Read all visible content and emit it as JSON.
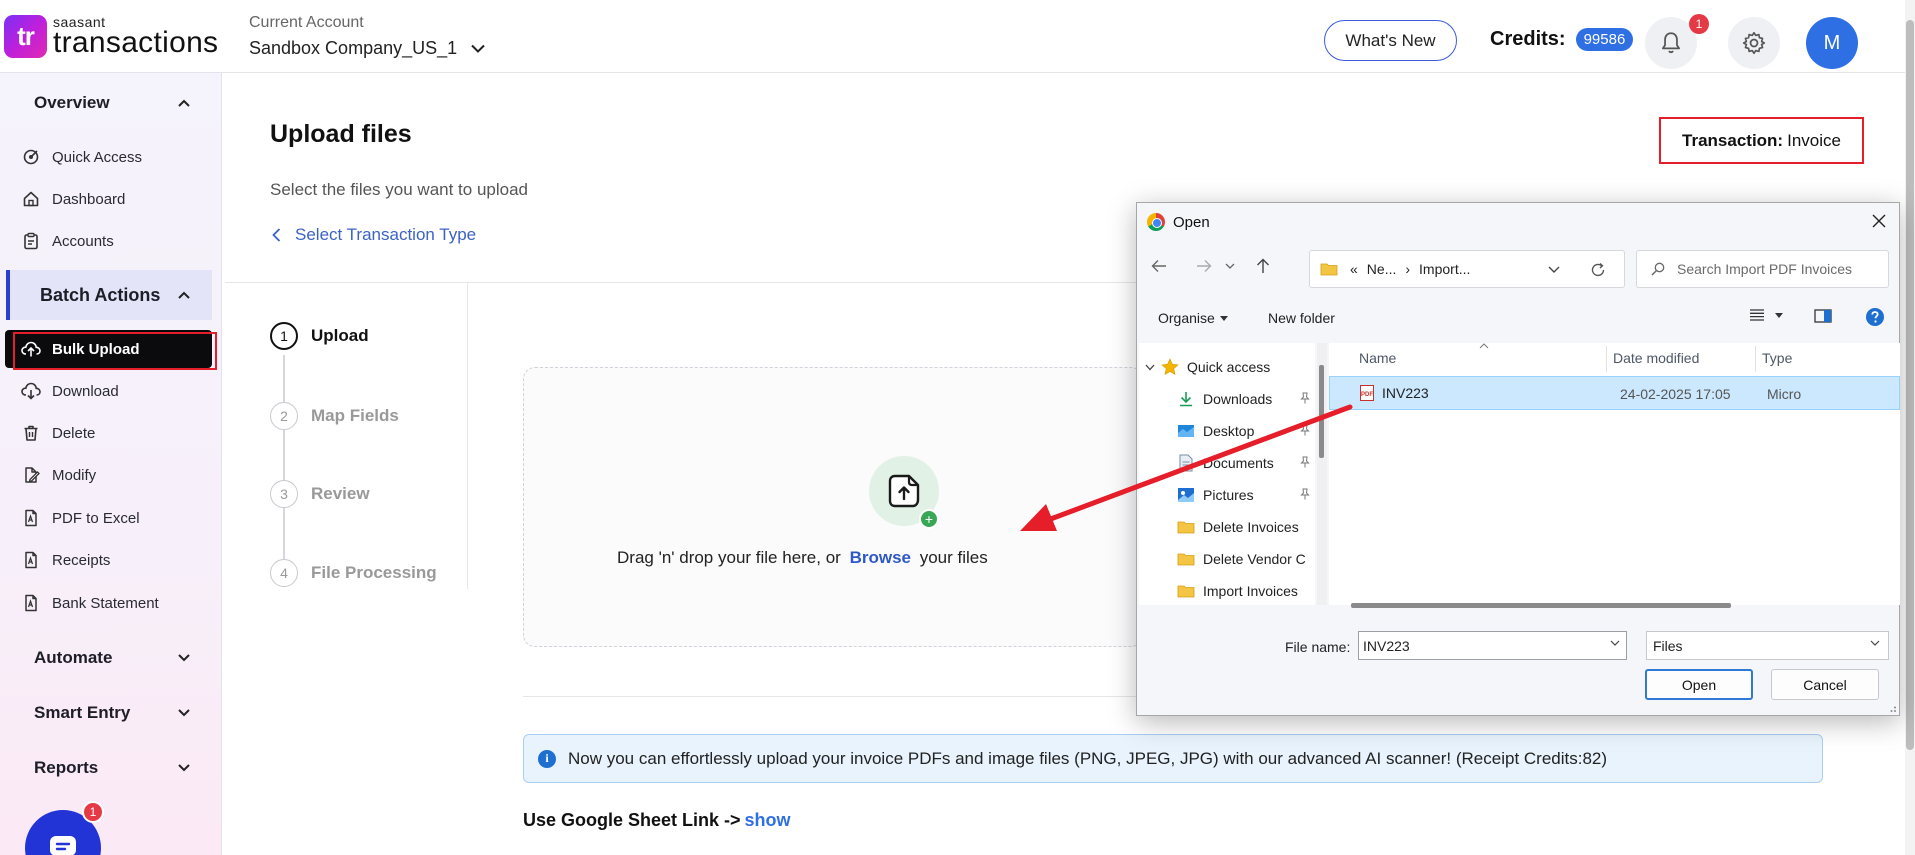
{
  "logo": {
    "line1": "saasant",
    "line2": "transactions",
    "mark": "tr"
  },
  "account": {
    "label": "Current Account",
    "name": "Sandbox Company_US_1"
  },
  "header": {
    "whats_new": "What's New",
    "credits_label": "Credits:",
    "credits_value": "99586",
    "notification_count": "1",
    "avatar_initial": "M"
  },
  "sidebar": {
    "overview": "Overview",
    "overview_items": [
      "Quick Access",
      "Dashboard",
      "Accounts"
    ],
    "batch_actions": "Batch Actions",
    "batch_items": [
      "Bulk Upload",
      "Download",
      "Delete",
      "Modify",
      "PDF to Excel",
      "Receipts",
      "Bank Statement"
    ],
    "automate": "Automate",
    "smart_entry": "Smart Entry",
    "reports": "Reports",
    "chat_badge": "1"
  },
  "main": {
    "title": "Upload files",
    "subtitle": "Select the files you want to upload",
    "back_link": "Select Transaction Type",
    "transaction_label": "Transaction:",
    "transaction_value": "Invoice",
    "steps": [
      {
        "num": "1",
        "label": "Upload"
      },
      {
        "num": "2",
        "label": "Map Fields"
      },
      {
        "num": "3",
        "label": "Review"
      },
      {
        "num": "4",
        "label": "File Processing"
      }
    ],
    "drop_text_before": "Drag 'n' drop your file here, or",
    "drop_browse": "Browse",
    "drop_text_after": "your files",
    "info_text": "Now you can effortlessly upload your invoice PDFs and image files (PNG, JPEG, JPG) with our advanced AI scanner! (Receipt Credits:82)",
    "gsheet_label": "Use Google Sheet Link ->",
    "gsheet_show": "show"
  },
  "dialog": {
    "title": "Open",
    "address_prefix": "«",
    "address_seg1": "Ne...",
    "address_sep": "›",
    "address_seg2": "Import...",
    "search_placeholder": "Search Import PDF Invoices",
    "organise": "Organise",
    "new_folder": "New folder",
    "nav_items": [
      "Quick access",
      "Downloads",
      "Desktop",
      "Documents",
      "Pictures",
      "Delete Invoices",
      "Delete Vendor C",
      "Import Invoices"
    ],
    "columns": {
      "name": "Name",
      "date": "Date modified",
      "type": "Type"
    },
    "file": {
      "name": "INV223",
      "date": "24-02-2025 17:05",
      "type": "Micro"
    },
    "file_name_label": "File name:",
    "file_name_value": "INV223",
    "file_type": "Files",
    "open_button": "Open",
    "cancel_button": "Cancel"
  },
  "colors": {
    "accent": "#2f6fe4",
    "annotation": "#e51e2a",
    "sidebar_active": "#0b0b0e"
  }
}
